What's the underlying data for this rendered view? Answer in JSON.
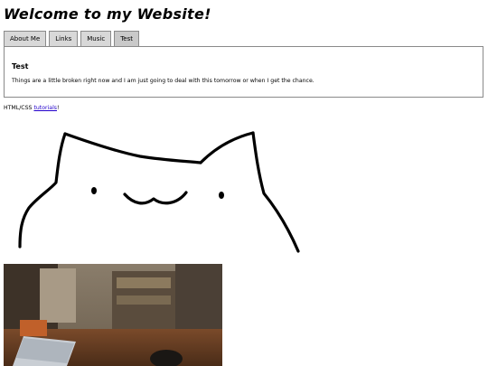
{
  "page": {
    "title": "Welcome to my Website!"
  },
  "tabs": [
    {
      "label": "About Me"
    },
    {
      "label": "Links"
    },
    {
      "label": "Music"
    },
    {
      "label": "Test",
      "active": true
    }
  ],
  "panel": {
    "heading": "Test",
    "body": "Things are a little broken right now and I am just going to deal with this tomorrow or when I get the chance."
  },
  "credit": {
    "prefix": "HTML/CSS ",
    "link_text": "tutorials",
    "suffix": "!"
  },
  "images": {
    "cat_drawing": "bongo-cat-sketch",
    "photo": "room-photo-with-laptop"
  },
  "colors": {
    "link": "#2200cc",
    "tab_bg": "#d8d8d8",
    "border": "#8a8a8a"
  }
}
